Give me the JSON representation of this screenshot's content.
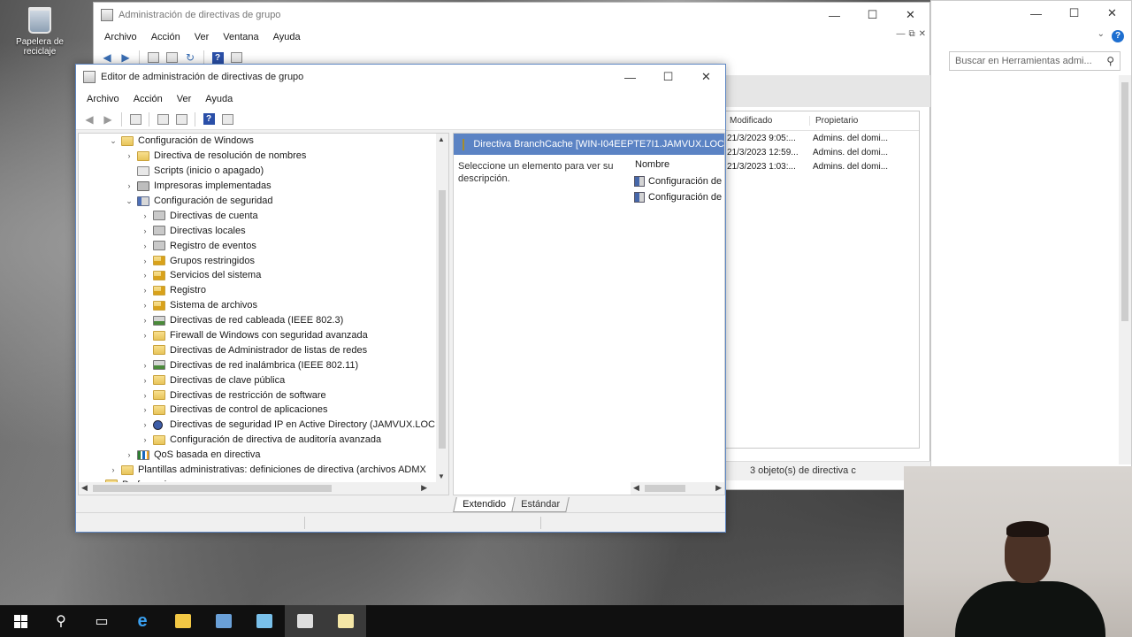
{
  "desktop": {
    "recycle_bin_label": "Papelera de reciclaje"
  },
  "bg_window": {
    "title": "Administración de directivas de grupo",
    "menu": [
      "Archivo",
      "Acción",
      "Ver",
      "Ventana",
      "Ayuda"
    ],
    "columns": [
      "Modificado",
      "Propietario"
    ],
    "rows": [
      [
        "21/3/2023 9:05:...",
        "Admins. del domi..."
      ],
      [
        "21/3/2023 12:59...",
        "Admins. del domi..."
      ],
      [
        "21/3/2023 1:03:...",
        "Admins. del domi..."
      ]
    ],
    "status": "3 objeto(s) de directiva c"
  },
  "right_window": {
    "search_placeholder": "Buscar en Herramientas admi..."
  },
  "main_window": {
    "title": "Editor de administración de directivas de grupo",
    "menu": [
      "Archivo",
      "Acción",
      "Ver",
      "Ayuda"
    ],
    "tree": [
      {
        "indent": 2,
        "expander": "open",
        "icon": "folder",
        "label": "Configuración de Windows"
      },
      {
        "indent": 3,
        "expander": "closed",
        "icon": "folder",
        "label": "Directiva de resolución de nombres"
      },
      {
        "indent": 3,
        "expander": "none",
        "icon": "doc",
        "label": "Scripts (inicio o apagado)"
      },
      {
        "indent": 3,
        "expander": "closed",
        "icon": "printer",
        "label": "Impresoras implementadas"
      },
      {
        "indent": 3,
        "expander": "open",
        "icon": "shield",
        "label": "Configuración de seguridad"
      },
      {
        "indent": 4,
        "expander": "closed",
        "icon": "book",
        "label": "Directivas de cuenta"
      },
      {
        "indent": 4,
        "expander": "closed",
        "icon": "book",
        "label": "Directivas locales"
      },
      {
        "indent": 4,
        "expander": "closed",
        "icon": "book",
        "label": "Registro de eventos"
      },
      {
        "indent": 4,
        "expander": "closed",
        "icon": "folder-lock",
        "label": "Grupos restringidos"
      },
      {
        "indent": 4,
        "expander": "closed",
        "icon": "folder-lock",
        "label": "Servicios del sistema"
      },
      {
        "indent": 4,
        "expander": "closed",
        "icon": "folder-lock",
        "label": "Registro"
      },
      {
        "indent": 4,
        "expander": "closed",
        "icon": "folder-lock",
        "label": "Sistema de archivos"
      },
      {
        "indent": 4,
        "expander": "closed",
        "icon": "wifi",
        "label": "Directivas de red cableada (IEEE 802.3)"
      },
      {
        "indent": 4,
        "expander": "closed",
        "icon": "folder",
        "label": "Firewall de Windows con seguridad avanzada"
      },
      {
        "indent": 4,
        "expander": "none",
        "icon": "folder",
        "label": "Directivas de Administrador de listas de redes"
      },
      {
        "indent": 4,
        "expander": "closed",
        "icon": "wifi",
        "label": "Directivas de red inalámbrica (IEEE 802.11)"
      },
      {
        "indent": 4,
        "expander": "closed",
        "icon": "folder",
        "label": "Directivas de clave pública"
      },
      {
        "indent": 4,
        "expander": "closed",
        "icon": "folder",
        "label": "Directivas de restricción de software"
      },
      {
        "indent": 4,
        "expander": "closed",
        "icon": "folder",
        "label": "Directivas de control de aplicaciones"
      },
      {
        "indent": 4,
        "expander": "closed",
        "icon": "globe",
        "label": "Directivas de seguridad IP en Active Directory (JAMVUX.LOC"
      },
      {
        "indent": 4,
        "expander": "closed",
        "icon": "folder",
        "label": "Configuración de directiva de auditoría avanzada"
      },
      {
        "indent": 3,
        "expander": "closed",
        "icon": "chart",
        "label": "QoS basada en directiva"
      },
      {
        "indent": 2,
        "expander": "closed",
        "icon": "folder",
        "label": "Plantillas administrativas: definiciones de directiva (archivos ADMX"
      },
      {
        "indent": 1,
        "expander": "closed",
        "icon": "folder",
        "label": "Preferencias"
      }
    ],
    "detail": {
      "header": "Directiva BranchCache [WIN-I04EEPTE7I1.JAMVUX.LOC",
      "description": "Seleccione un elemento para ver su descripción.",
      "name_column": "Nombre",
      "items": [
        "Configuración de",
        "Configuración de"
      ]
    },
    "tabs": [
      "Extendido",
      "Estándar"
    ]
  },
  "colors": {
    "selection_blue": "#5b83c4",
    "taskbar": "#101010"
  },
  "taskbar": {
    "icons": [
      "windows-start-icon",
      "search-icon",
      "task-view-icon",
      "internet-explorer-icon",
      "file-explorer-icon",
      "server-manager-icon",
      "network-icon",
      "group-policy-icon",
      "notepad-icon"
    ]
  }
}
